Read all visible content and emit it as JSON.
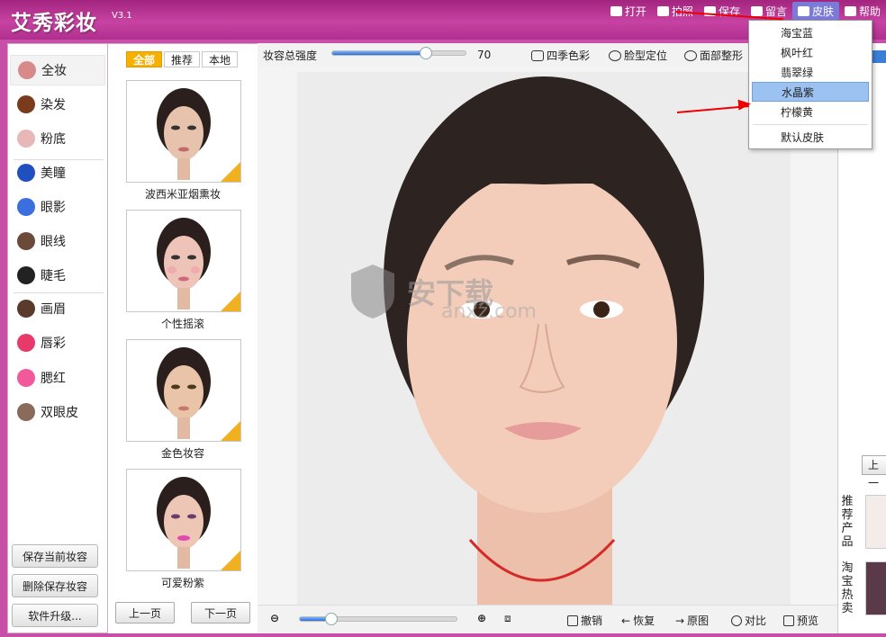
{
  "app": {
    "title": "艾秀彩妆",
    "version": "V3.1"
  },
  "top_menu": [
    {
      "label": "打开",
      "icon": "folder-icon"
    },
    {
      "label": "拍照",
      "icon": "camera-icon"
    },
    {
      "label": "保存",
      "icon": "save-icon"
    },
    {
      "label": "留言",
      "icon": "message-icon"
    },
    {
      "label": "皮肤",
      "icon": "skin-icon"
    },
    {
      "label": "帮助",
      "icon": "help-icon"
    }
  ],
  "skin_menu": {
    "items": [
      "海宝蓝",
      "枫叶红",
      "翡翠绿",
      "水晶紫",
      "柠檬黄"
    ],
    "highlighted": "水晶紫",
    "default_label": "默认皮肤"
  },
  "categories": [
    {
      "label": "全妆",
      "icon": "full-makeup-icon",
      "color": "#d88a8a"
    },
    {
      "label": "染发",
      "icon": "hair-dye-icon",
      "color": "#7a3b1c"
    },
    {
      "label": "粉底",
      "icon": "foundation-icon",
      "color": "#e8b8b8"
    },
    {
      "label": "美瞳",
      "icon": "contact-lens-icon",
      "color": "#2050c0"
    },
    {
      "label": "眼影",
      "icon": "eyeshadow-icon",
      "color": "#3b6fe0"
    },
    {
      "label": "眼线",
      "icon": "eyeliner-icon",
      "color": "#6b4a3a"
    },
    {
      "label": "睫毛",
      "icon": "eyelash-icon",
      "color": "#222222"
    },
    {
      "label": "画眉",
      "icon": "eyebrow-icon",
      "color": "#5a3a2a"
    },
    {
      "label": "唇彩",
      "icon": "lip-gloss-icon",
      "color": "#e83a6a"
    },
    {
      "label": "腮红",
      "icon": "blush-icon",
      "color": "#f05a9a"
    },
    {
      "label": "双眼皮",
      "icon": "double-eyelid-icon",
      "color": "#8a6a5a"
    }
  ],
  "left_buttons": {
    "save_current": "保存当前妆容",
    "delete_saved": "删除保存妆容",
    "upgrade": "软件升级..."
  },
  "filter_tabs": [
    "全部",
    "推荐",
    "本地"
  ],
  "looks": [
    {
      "label": "波西米亚烟熏妆"
    },
    {
      "label": "个性摇滚"
    },
    {
      "label": "金色妆容"
    },
    {
      "label": "可爱粉紫"
    }
  ],
  "paging": {
    "prev": "上一页",
    "next": "下一页"
  },
  "toolbar": {
    "intensity_label": "妆容总强度",
    "intensity_value": "70",
    "intensity_level": 0.7,
    "seasons": "四季色彩",
    "face_locate": "脸型定位",
    "face_shape": "面部整形"
  },
  "bottom_bar": {
    "zoom_level": 0.2,
    "undo": "撤销",
    "redo": "恢复",
    "original": "原图",
    "compare": "对比",
    "preview": "预览"
  },
  "watermark": {
    "text": "安下载",
    "url": "anxz.com"
  },
  "right_panel": {
    "button": "上一",
    "recommend": "推荐产品",
    "taobao": "淘宝热卖"
  }
}
